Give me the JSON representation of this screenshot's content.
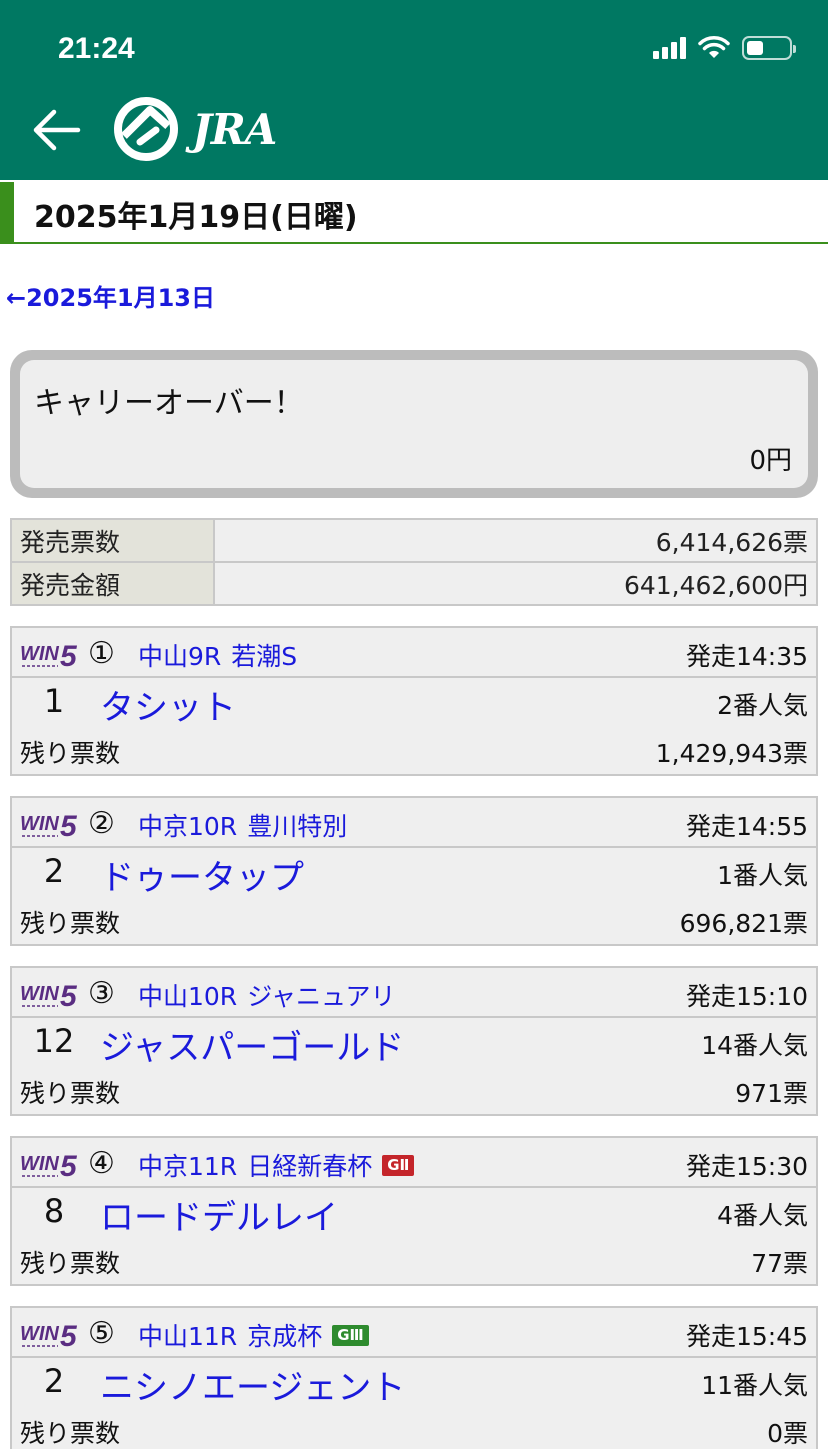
{
  "status": {
    "time": "21:24"
  },
  "header": {
    "logo_text": "JRA"
  },
  "date_title": "2025年1月19日(日曜)",
  "prev_link": "←2025年1月13日",
  "carryover": {
    "title": "キャリーオーバー！",
    "amount": "0円"
  },
  "sales": [
    {
      "label": "発売票数",
      "value": "6,414,626票"
    },
    {
      "label": "発売金額",
      "value": "641,462,600円"
    }
  ],
  "races": [
    {
      "num": "①",
      "venue": "中山9R",
      "name": "若潮S",
      "grade": "",
      "start": "発走14:35",
      "horse_no": "1",
      "horse": "タシット",
      "popularity": "2番人気",
      "remaining_label": "残り票数",
      "remaining": "1,429,943票"
    },
    {
      "num": "②",
      "venue": "中京10R",
      "name": "豊川特別",
      "grade": "",
      "start": "発走14:55",
      "horse_no": "2",
      "horse": "ドゥータップ",
      "popularity": "1番人気",
      "remaining_label": "残り票数",
      "remaining": "696,821票"
    },
    {
      "num": "③",
      "venue": "中山10R",
      "name": "ジャニュアリ",
      "grade": "",
      "start": "発走15:10",
      "horse_no": "12",
      "horse": "ジャスパーゴールド",
      "popularity": "14番人気",
      "remaining_label": "残り票数",
      "remaining": "971票"
    },
    {
      "num": "④",
      "venue": "中京11R",
      "name": "日経新春杯",
      "grade": "GⅡ",
      "start": "発走15:30",
      "horse_no": "8",
      "horse": "ロードデルレイ",
      "popularity": "4番人気",
      "remaining_label": "残り票数",
      "remaining": "77票"
    },
    {
      "num": "⑤",
      "venue": "中山11R",
      "name": "京成杯",
      "grade": "GⅢ",
      "start": "発走15:45",
      "horse_no": "2",
      "horse": "ニシノエージェント",
      "popularity": "11番人気",
      "remaining_label": "残り票数",
      "remaining": "0票"
    }
  ],
  "colors": {
    "header_green": "#007862",
    "accent_green": "#3a8f1c",
    "link_blue": "#1a1adb",
    "win5_purple": "#5a2d82",
    "grade2_red": "#c4252a",
    "grade3_green": "#2e8b2e"
  }
}
